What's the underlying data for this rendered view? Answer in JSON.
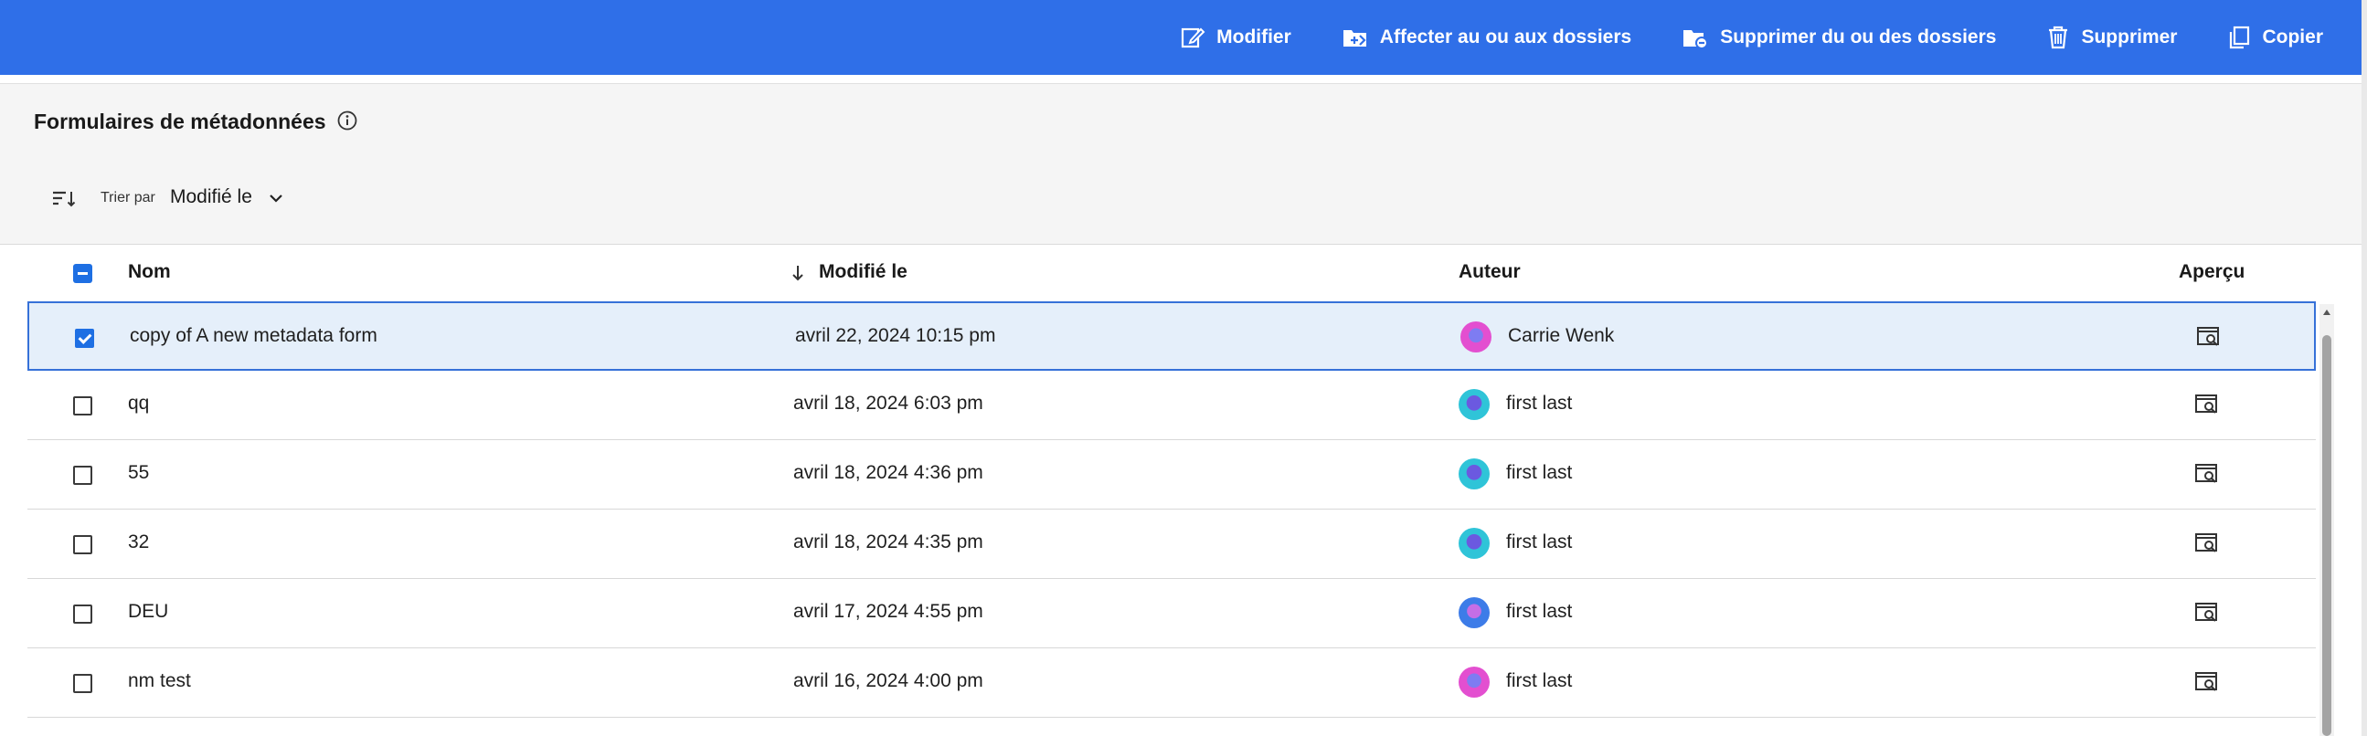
{
  "toolbar": {
    "actions": [
      {
        "label": "Modifier",
        "icon": "edit-icon"
      },
      {
        "label": "Affecter au ou aux dossiers",
        "icon": "folder-assign-icon"
      },
      {
        "label": "Supprimer du ou des dossiers",
        "icon": "folder-remove-icon"
      },
      {
        "label": "Supprimer",
        "icon": "trash-icon"
      },
      {
        "label": "Copier",
        "icon": "copy-icon"
      }
    ],
    "background": "#2f6fe8"
  },
  "header": {
    "title": "Formulaires de métadonnées",
    "sort": {
      "label": "Trier par",
      "value": "Modifié le"
    }
  },
  "table": {
    "columns": {
      "name": "Nom",
      "modified": "Modifié le",
      "author": "Auteur",
      "preview": "Aperçu"
    },
    "rows": [
      {
        "name": "copy of A new metadata form",
        "modified": "avril 22, 2024 10:15 pm",
        "author": "Carrie Wenk",
        "selected": true
      },
      {
        "name": "qq",
        "modified": "avril 18, 2024 6:03 pm",
        "author": "first last",
        "selected": false
      },
      {
        "name": "55",
        "modified": "avril 18, 2024 4:36 pm",
        "author": "first last",
        "selected": false
      },
      {
        "name": "32",
        "modified": "avril 18, 2024 4:35 pm",
        "author": "first last",
        "selected": false
      },
      {
        "name": "DEU",
        "modified": "avril 17, 2024 4:55 pm",
        "author": "first last",
        "selected": false
      },
      {
        "name": "nm test",
        "modified": "avril 16, 2024 4:00 pm",
        "author": "first last",
        "selected": false
      }
    ]
  }
}
